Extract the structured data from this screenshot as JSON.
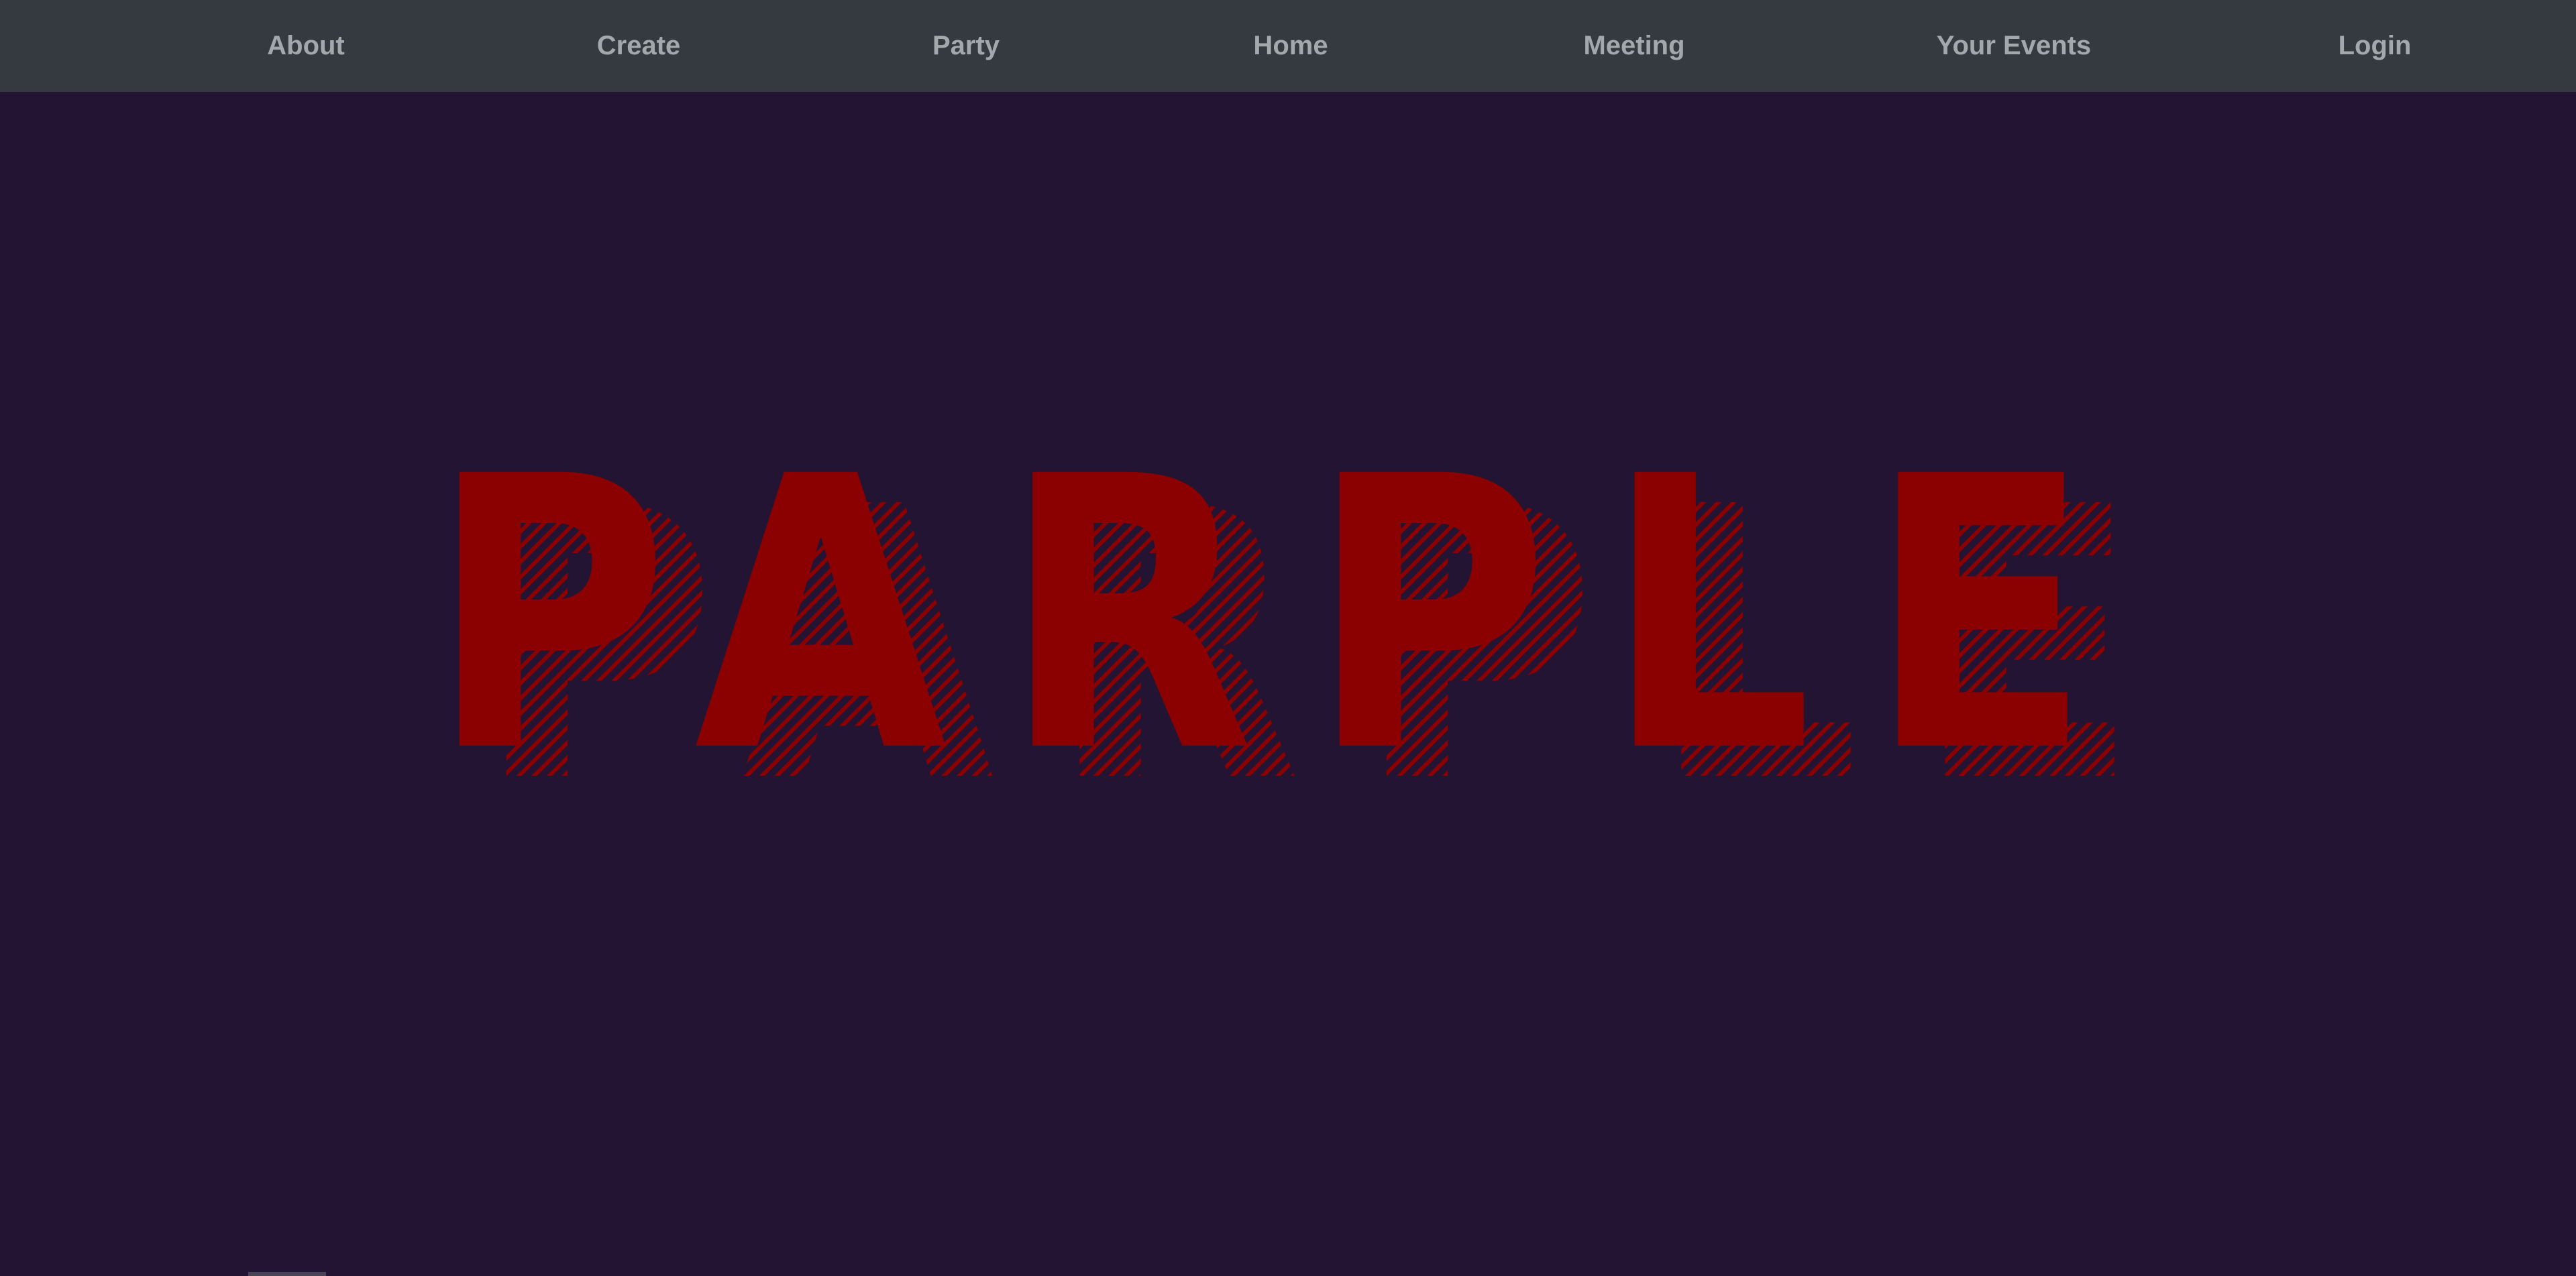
{
  "nav": {
    "items": [
      {
        "id": "about",
        "label": "About"
      },
      {
        "id": "create",
        "label": "Create"
      },
      {
        "id": "party",
        "label": "Party"
      },
      {
        "id": "home",
        "label": "Home"
      },
      {
        "id": "meeting",
        "label": "Meeting"
      },
      {
        "id": "your-events",
        "label": "Your Events"
      },
      {
        "id": "login",
        "label": "Login"
      }
    ]
  },
  "hero": {
    "title": "PARPLE",
    "title_color": "#8b0000",
    "background_color": "#221432"
  },
  "colors": {
    "navbar": "#343a40",
    "nav_text": "#a3a8ad"
  }
}
